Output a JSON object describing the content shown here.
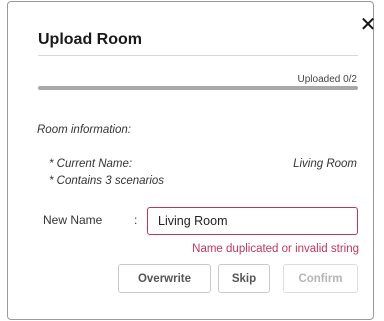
{
  "dialog": {
    "title": "Upload Room",
    "close_glyph": "✕",
    "close_icon": "close-icon"
  },
  "progress": {
    "label": "Uploaded 0/2",
    "fraction": 0
  },
  "room_info": {
    "section_title": "Room information:",
    "current_name_label": "* Current Name:",
    "current_name_value": "Living Room",
    "scenarios_text": "* Contains 3 scenarios"
  },
  "new_name": {
    "label": "New Name",
    "colon": ":",
    "value": "Living Room",
    "error": "Name duplicated or invalid string"
  },
  "buttons": {
    "overwrite": "Overwrite",
    "skip": "Skip",
    "confirm": "Confirm"
  },
  "colors": {
    "error": "#c0375a",
    "progress_track": "#a8a8a8",
    "disabled_text": "#b5b5b5"
  }
}
